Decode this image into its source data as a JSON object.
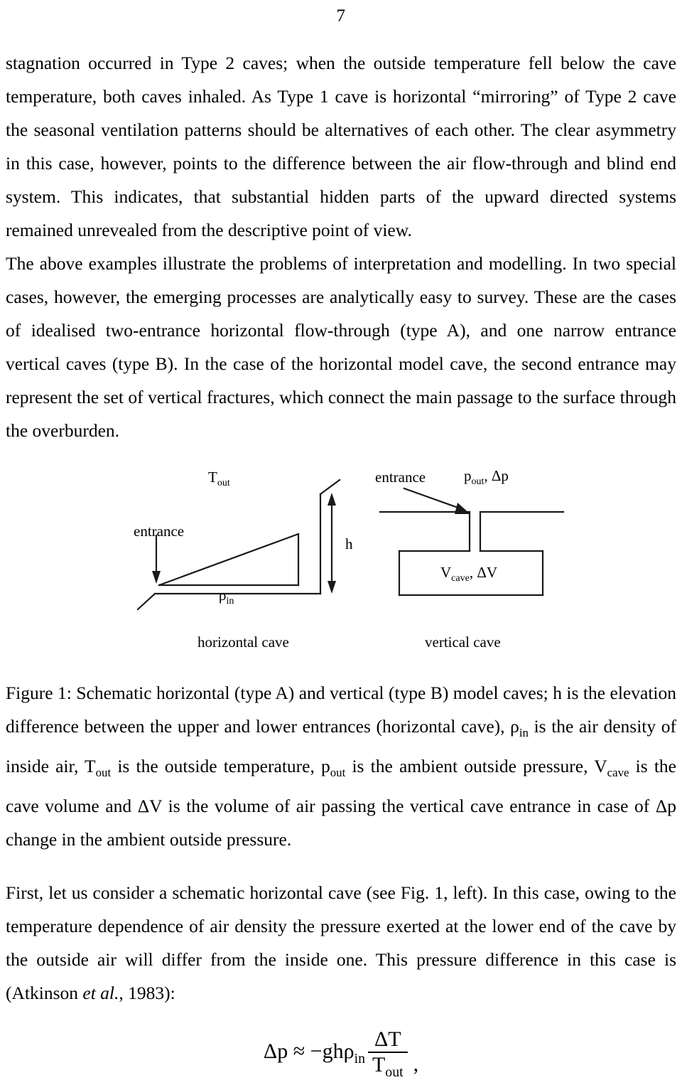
{
  "page": {
    "number": "7"
  },
  "paragraphs": {
    "p1": "stagnation occurred in Type 2 caves; when the outside temperature fell below the cave temperature, both caves inhaled. As Type 1 cave is horizontal “mirroring” of Type 2 cave the seasonal ventilation patterns should be alternatives of each other. The clear asymmetry in this case, however, points to the difference between the air flow-through and blind end system. This indicates, that  substantial hidden parts of the upward directed systems remained unrevealed from the descriptive point of view.",
    "p2": "The above examples illustrate the problems of interpretation and modelling. In two special cases, however, the emerging processes are analytically easy to survey. These are the cases of idealised two-entrance horizontal flow-through (type A), and one narrow entrance vertical caves (type B). In the case of the horizontal model cave, the second entrance may represent the set of vertical fractures, which connect the main passage to the surface through the overburden.",
    "p3_part1": "First, let us consider a schematic horizontal cave (see Fig. 1, left). In this case, owing to the temperature dependence of air density the pressure exerted at the lower end of the cave by the outside air will differ from the inside one. This pressure difference in this case is (Atkinson ",
    "p3_italic": "et al.",
    "p3_part2": ", 1983):"
  },
  "figure": {
    "horizontal_cave": {
      "label_T_out_base": "T",
      "label_T_out_sub": "out",
      "label_entrance": "entrance",
      "label_rho_in_base": "ρ",
      "label_rho_in_sub": "in",
      "label_h": "h",
      "caption_under": "horizontal cave"
    },
    "vertical_cave": {
      "label_entrance": "entrance",
      "label_p_out_base": "p",
      "label_p_out_sub": "out",
      "label_delta_p": ", Δp",
      "label_V_cave_base": "V",
      "label_V_cave_sub": "cave",
      "label_delta_V": ", ΔV",
      "caption_under": "vertical cave"
    },
    "caption": {
      "line": "Figure 1: Schematic horizontal (type A) and vertical (type B) model caves; h is the elevation difference between the upper and lower entrances (horizontal cave), ρ",
      "sub1": "in",
      "line2": " is the air density of inside air, T",
      "sub2": "out",
      "line3": " is the outside temperature, p",
      "sub3": "out",
      "line4": " is the ambient outside pressure, V",
      "sub4": "cave",
      "line5": " is the cave volume and ΔV is the volume of air passing the vertical cave entrance in case of Δp change in the ambient outside pressure."
    }
  },
  "equation": {
    "lhs": "Δp ≈ −ghρ",
    "lhs_sub": "in",
    "numerator": "ΔT",
    "denominator_base": "T",
    "denominator_sub": "out",
    "trailing": ","
  },
  "colors": {
    "text": "#000000",
    "background": "#ffffff",
    "stroke": "#1a1a1a"
  }
}
